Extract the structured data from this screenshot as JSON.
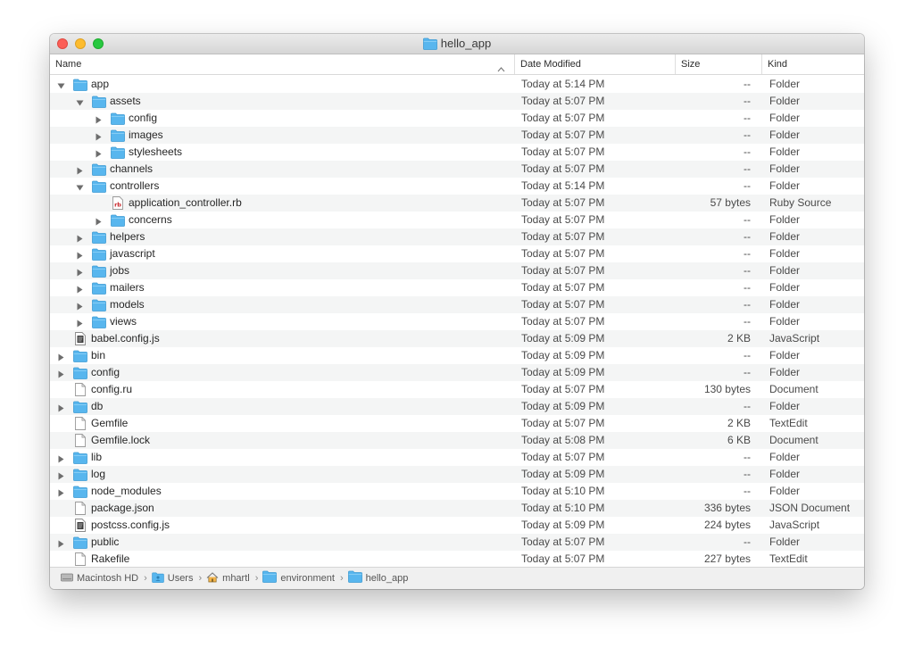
{
  "window": {
    "title": "hello_app"
  },
  "columns": {
    "name": "Name",
    "date": "Date Modified",
    "size": "Size",
    "kind": "Kind"
  },
  "rows": [
    {
      "name": "app",
      "depth": 0,
      "icon": "folder-icon",
      "disclosure": "expanded",
      "date": "Today at 5:14 PM",
      "size": "--",
      "kind": "Folder"
    },
    {
      "name": "assets",
      "depth": 1,
      "icon": "folder-icon",
      "disclosure": "expanded",
      "date": "Today at 5:07 PM",
      "size": "--",
      "kind": "Folder"
    },
    {
      "name": "config",
      "depth": 2,
      "icon": "folder-icon",
      "disclosure": "collapsed",
      "date": "Today at 5:07 PM",
      "size": "--",
      "kind": "Folder"
    },
    {
      "name": "images",
      "depth": 2,
      "icon": "folder-icon",
      "disclosure": "collapsed",
      "date": "Today at 5:07 PM",
      "size": "--",
      "kind": "Folder"
    },
    {
      "name": "stylesheets",
      "depth": 2,
      "icon": "folder-icon",
      "disclosure": "collapsed",
      "date": "Today at 5:07 PM",
      "size": "--",
      "kind": "Folder"
    },
    {
      "name": "channels",
      "depth": 1,
      "icon": "folder-icon",
      "disclosure": "collapsed",
      "date": "Today at 5:07 PM",
      "size": "--",
      "kind": "Folder"
    },
    {
      "name": "controllers",
      "depth": 1,
      "icon": "folder-icon",
      "disclosure": "expanded",
      "date": "Today at 5:14 PM",
      "size": "--",
      "kind": "Folder"
    },
    {
      "name": "application_controller.rb",
      "depth": 2,
      "icon": "ruby-file-icon",
      "disclosure": "none",
      "date": "Today at 5:07 PM",
      "size": "57 bytes",
      "kind": "Ruby Source"
    },
    {
      "name": "concerns",
      "depth": 2,
      "icon": "folder-icon",
      "disclosure": "collapsed",
      "date": "Today at 5:07 PM",
      "size": "--",
      "kind": "Folder"
    },
    {
      "name": "helpers",
      "depth": 1,
      "icon": "folder-icon",
      "disclosure": "collapsed",
      "date": "Today at 5:07 PM",
      "size": "--",
      "kind": "Folder"
    },
    {
      "name": "javascript",
      "depth": 1,
      "icon": "folder-icon",
      "disclosure": "collapsed",
      "date": "Today at 5:07 PM",
      "size": "--",
      "kind": "Folder"
    },
    {
      "name": "jobs",
      "depth": 1,
      "icon": "folder-icon",
      "disclosure": "collapsed",
      "date": "Today at 5:07 PM",
      "size": "--",
      "kind": "Folder"
    },
    {
      "name": "mailers",
      "depth": 1,
      "icon": "folder-icon",
      "disclosure": "collapsed",
      "date": "Today at 5:07 PM",
      "size": "--",
      "kind": "Folder"
    },
    {
      "name": "models",
      "depth": 1,
      "icon": "folder-icon",
      "disclosure": "collapsed",
      "date": "Today at 5:07 PM",
      "size": "--",
      "kind": "Folder"
    },
    {
      "name": "views",
      "depth": 1,
      "icon": "folder-icon",
      "disclosure": "collapsed",
      "date": "Today at 5:07 PM",
      "size": "--",
      "kind": "Folder"
    },
    {
      "name": "babel.config.js",
      "depth": 0,
      "icon": "script-file-icon",
      "disclosure": "none",
      "date": "Today at 5:09 PM",
      "size": "2 KB",
      "kind": "JavaScript"
    },
    {
      "name": "bin",
      "depth": 0,
      "icon": "folder-icon",
      "disclosure": "collapsed",
      "date": "Today at 5:09 PM",
      "size": "--",
      "kind": "Folder"
    },
    {
      "name": "config",
      "depth": 0,
      "icon": "folder-icon",
      "disclosure": "collapsed",
      "date": "Today at 5:09 PM",
      "size": "--",
      "kind": "Folder"
    },
    {
      "name": "config.ru",
      "depth": 0,
      "icon": "document-icon",
      "disclosure": "none",
      "date": "Today at 5:07 PM",
      "size": "130 bytes",
      "kind": "Document"
    },
    {
      "name": "db",
      "depth": 0,
      "icon": "folder-icon",
      "disclosure": "collapsed",
      "date": "Today at 5:09 PM",
      "size": "--",
      "kind": "Folder"
    },
    {
      "name": "Gemfile",
      "depth": 0,
      "icon": "document-icon",
      "disclosure": "none",
      "date": "Today at 5:07 PM",
      "size": "2 KB",
      "kind": "TextEdit"
    },
    {
      "name": "Gemfile.lock",
      "depth": 0,
      "icon": "document-icon",
      "disclosure": "none",
      "date": "Today at 5:08 PM",
      "size": "6 KB",
      "kind": "Document"
    },
    {
      "name": "lib",
      "depth": 0,
      "icon": "folder-icon",
      "disclosure": "collapsed",
      "date": "Today at 5:07 PM",
      "size": "--",
      "kind": "Folder"
    },
    {
      "name": "log",
      "depth": 0,
      "icon": "folder-icon",
      "disclosure": "collapsed",
      "date": "Today at 5:09 PM",
      "size": "--",
      "kind": "Folder"
    },
    {
      "name": "node_modules",
      "depth": 0,
      "icon": "folder-icon",
      "disclosure": "collapsed",
      "date": "Today at 5:10 PM",
      "size": "--",
      "kind": "Folder"
    },
    {
      "name": "package.json",
      "depth": 0,
      "icon": "document-icon",
      "disclosure": "none",
      "date": "Today at 5:10 PM",
      "size": "336 bytes",
      "kind": "JSON Document"
    },
    {
      "name": "postcss.config.js",
      "depth": 0,
      "icon": "script-file-icon",
      "disclosure": "none",
      "date": "Today at 5:09 PM",
      "size": "224 bytes",
      "kind": "JavaScript"
    },
    {
      "name": "public",
      "depth": 0,
      "icon": "folder-icon",
      "disclosure": "collapsed",
      "date": "Today at 5:07 PM",
      "size": "--",
      "kind": "Folder"
    },
    {
      "name": "Rakefile",
      "depth": 0,
      "icon": "document-icon",
      "disclosure": "none",
      "date": "Today at 5:07 PM",
      "size": "227 bytes",
      "kind": "TextEdit"
    }
  ],
  "pathbar": [
    {
      "label": "Macintosh HD",
      "icon": "hard-drive-icon"
    },
    {
      "label": "Users",
      "icon": "users-folder-icon"
    },
    {
      "label": "mhartl",
      "icon": "home-icon"
    },
    {
      "label": "environment",
      "icon": "folder-icon"
    },
    {
      "label": "hello_app",
      "icon": "folder-icon"
    }
  ]
}
